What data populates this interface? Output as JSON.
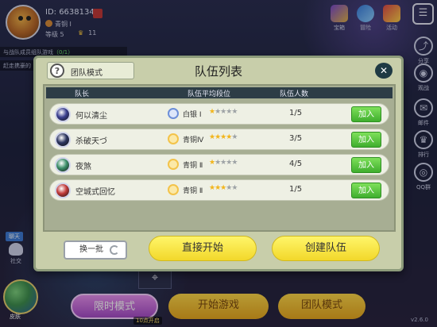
{
  "player": {
    "id_label": "ID: 6638134",
    "rank": "青铜 I",
    "level": "等级 5",
    "trophies": "11"
  },
  "chat_lines": [
    {
      "text": "与战队成员组队游戏",
      "highlight": "（0/1）"
    },
    {
      "text": "赶走携豪的"
    }
  ],
  "top_icons": [
    {
      "label": "宝箱",
      "icon": "treasure-chest-icon"
    },
    {
      "label": "冒险",
      "icon": "adventure-hat-icon"
    },
    {
      "label": "活动",
      "icon": "gift-icon"
    }
  ],
  "right_menu": [
    {
      "label": "分享",
      "icon": "share-icon",
      "glyph": "⤴"
    },
    {
      "label": "观战",
      "icon": "eye-icon",
      "glyph": "◉"
    },
    {
      "label": "邮件",
      "icon": "mail-icon",
      "glyph": "✉"
    },
    {
      "label": "排行",
      "icon": "trophy-icon",
      "glyph": "♛"
    },
    {
      "label": "QQ群",
      "icon": "qq-group-icon",
      "glyph": "◎"
    }
  ],
  "side": {
    "chat_tag": "聊天",
    "social_label": "社交",
    "skin_label": "皮肤"
  },
  "bottom": {
    "timed_mode": "限时模式",
    "open_time": "10点开启",
    "start_game": "开始游戏",
    "team_mode": "团队模式",
    "version": "v2.6.0"
  },
  "dialog": {
    "mode_label": "团队模式",
    "title": "队伍列表",
    "close_glyph": "✕",
    "columns": {
      "leader": "队长",
      "avg_rank": "队伍平均段位",
      "members": "队伍人数"
    },
    "teams": [
      {
        "leader": "何以清尘",
        "rank": "白银 I",
        "rank_tier": "silver",
        "stars_filled": 1,
        "stars_total": 5,
        "members": "1/5",
        "join": "加入",
        "avatar_color": "#3a3f8f"
      },
      {
        "leader": "杀破天づ",
        "rank": "青铜Ⅳ",
        "rank_tier": "bronze",
        "stars_filled": 4,
        "stars_total": 5,
        "members": "3/5",
        "join": "加入",
        "avatar_color": "#2c3560"
      },
      {
        "leader": "夜煞",
        "rank": "青铜 Ⅱ",
        "rank_tier": "bronze",
        "stars_filled": 1,
        "stars_total": 5,
        "members": "4/5",
        "join": "加入",
        "avatar_color": "#3c8f6a"
      },
      {
        "leader": "空城式回忆",
        "rank": "青铜 Ⅱ",
        "rank_tier": "bronze",
        "stars_filled": 3,
        "stars_total": 5,
        "members": "1/5",
        "join": "加入",
        "avatar_color": "#c23a3a"
      }
    ],
    "refresh_label": "换一批",
    "start_label": "直接开始",
    "create_label": "创建队伍"
  }
}
